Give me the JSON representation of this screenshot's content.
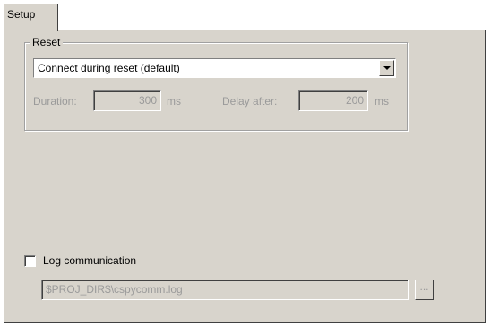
{
  "tabs": [
    {
      "label": "Setup"
    }
  ],
  "reset_group": {
    "title": "Reset",
    "mode_selected": "Connect during reset (default)",
    "duration": {
      "label": "Duration:",
      "value": "300",
      "unit": "ms"
    },
    "delay_after": {
      "label": "Delay after:",
      "value": "200",
      "unit": "ms"
    }
  },
  "log": {
    "checkbox_label": "Log communication",
    "checked": false,
    "path": "$PROJ_DIR$\\cspycomm.log",
    "browse_label": "..."
  }
}
